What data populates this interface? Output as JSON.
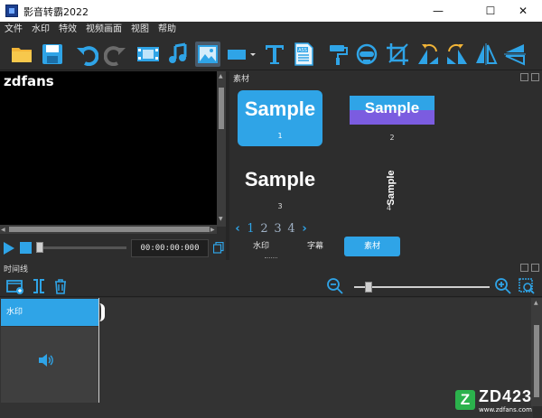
{
  "window": {
    "title": "影音转霸2022",
    "min": "—",
    "max": "☐",
    "close": "✕"
  },
  "menu": [
    "文件",
    "水印",
    "特效",
    "视频画面",
    "视图",
    "帮助"
  ],
  "toolbar": {
    "icons": [
      "open-folder-icon",
      "save-icon",
      "undo-icon",
      "redo-icon",
      "video-clip-icon",
      "music-note-icon",
      "image-icon",
      "rectangle-shape-icon",
      "text-icon",
      "subtitle-ass-icon",
      "paint-roller-icon",
      "mask-icon",
      "crop-icon",
      "rotate-left-icon",
      "rotate-right-icon",
      "flip-horizontal-icon",
      "flip-vertical-icon"
    ],
    "ass_label": "ASS",
    "text_label": "T"
  },
  "preview": {
    "overlay_text": "zdfans"
  },
  "playback": {
    "timecode": "00:00:00:000"
  },
  "material_panel": {
    "title": "素材",
    "samples": [
      {
        "text": "Sample",
        "index": "1"
      },
      {
        "text": "Sample",
        "index": "2"
      },
      {
        "text": "Sample",
        "index": "3"
      },
      {
        "text": "Sample",
        "index": "4"
      }
    ],
    "pager": {
      "prev": "‹",
      "next": "›",
      "pages": [
        "1",
        "2",
        "3",
        "4"
      ],
      "current": "1"
    },
    "tabs": [
      {
        "label": "水印",
        "active": false
      },
      {
        "label": "字幕",
        "active": false
      },
      {
        "label": "素材",
        "active": true
      }
    ]
  },
  "timeline": {
    "title": "时间线",
    "track_label": "水印"
  },
  "watermark": {
    "logo": "Z",
    "text": "ZD423",
    "url": "www.zdfans.com"
  },
  "colors": {
    "accent": "#2fa4e7",
    "bg": "#2d2d2d",
    "preview": "#000000"
  }
}
